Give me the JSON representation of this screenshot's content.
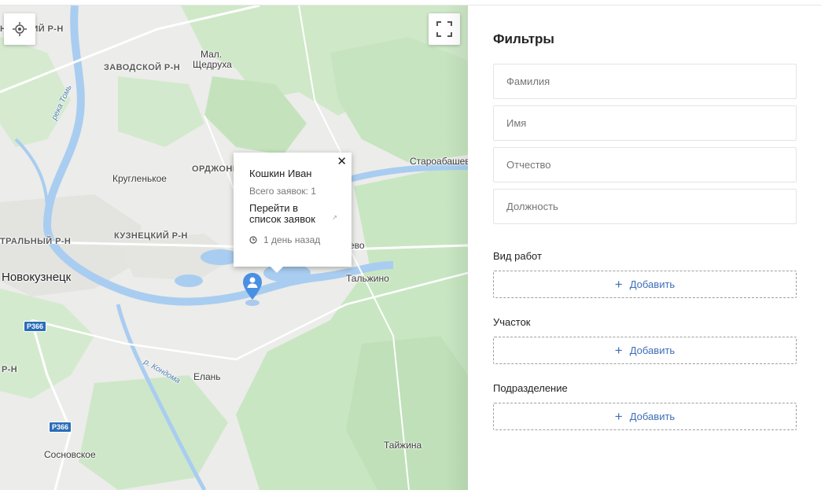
{
  "map": {
    "labels": {
      "zavodskoy": "ЗАВОДСКОЙ Р-Н",
      "top_left_district": "НИНСКИЙ Р-Н",
      "mal_shchedrukha_1": "Мал.",
      "mal_shchedrukha_2": "Щедруха",
      "reka_tom": "река Томь",
      "kruglenkoe": "Кругленькое",
      "ordzhoni": "ОРДЖОНИ",
      "staroabashevo": "Староабашев",
      "central_district": "ТРАЛЬНЫЙ Р-Н",
      "kuznetsky_district": "КУЗНЕЦКИЙ Р-Н",
      "novokuznetsk": "Новокузнецк",
      "vo_partial": "ево",
      "talzhino": "Тальжино",
      "r_kondoma": "р. Кондома",
      "elan": "Елань",
      "rn_left": "Р-Н",
      "sosnovskoe": "Сосновское",
      "tayzhina": "Тайжина",
      "road_r366_a": "Р366",
      "road_r366_b": "Р366"
    },
    "controls": {
      "locate_icon": "crosshair-icon",
      "fullscreen_icon": "fullscreen-icon"
    },
    "popup": {
      "name": "Кошкин Иван",
      "count": "Всего заявок: 1",
      "link_line1": "Перейти в",
      "link_line2": "список заявок",
      "time": "1 день назад",
      "close": "✕"
    },
    "marker_icon": "person-pin-icon",
    "colors": {
      "water": "#a9cdf0",
      "forest": "#c8e6c2",
      "land": "#ececea",
      "marker": "#4a90e2"
    }
  },
  "filters": {
    "title": "Фильтры",
    "fields": {
      "surname": "Фамилия",
      "name": "Имя",
      "patronymic": "Отчество",
      "position": "Должность"
    },
    "sections": {
      "work_type": {
        "label": "Вид работ",
        "button": "Добавить"
      },
      "area": {
        "label": "Участок",
        "button": "Добавить"
      },
      "division": {
        "label": "Подразделение",
        "button": "Добавить"
      }
    },
    "accent_color": "#3f6fb7"
  }
}
